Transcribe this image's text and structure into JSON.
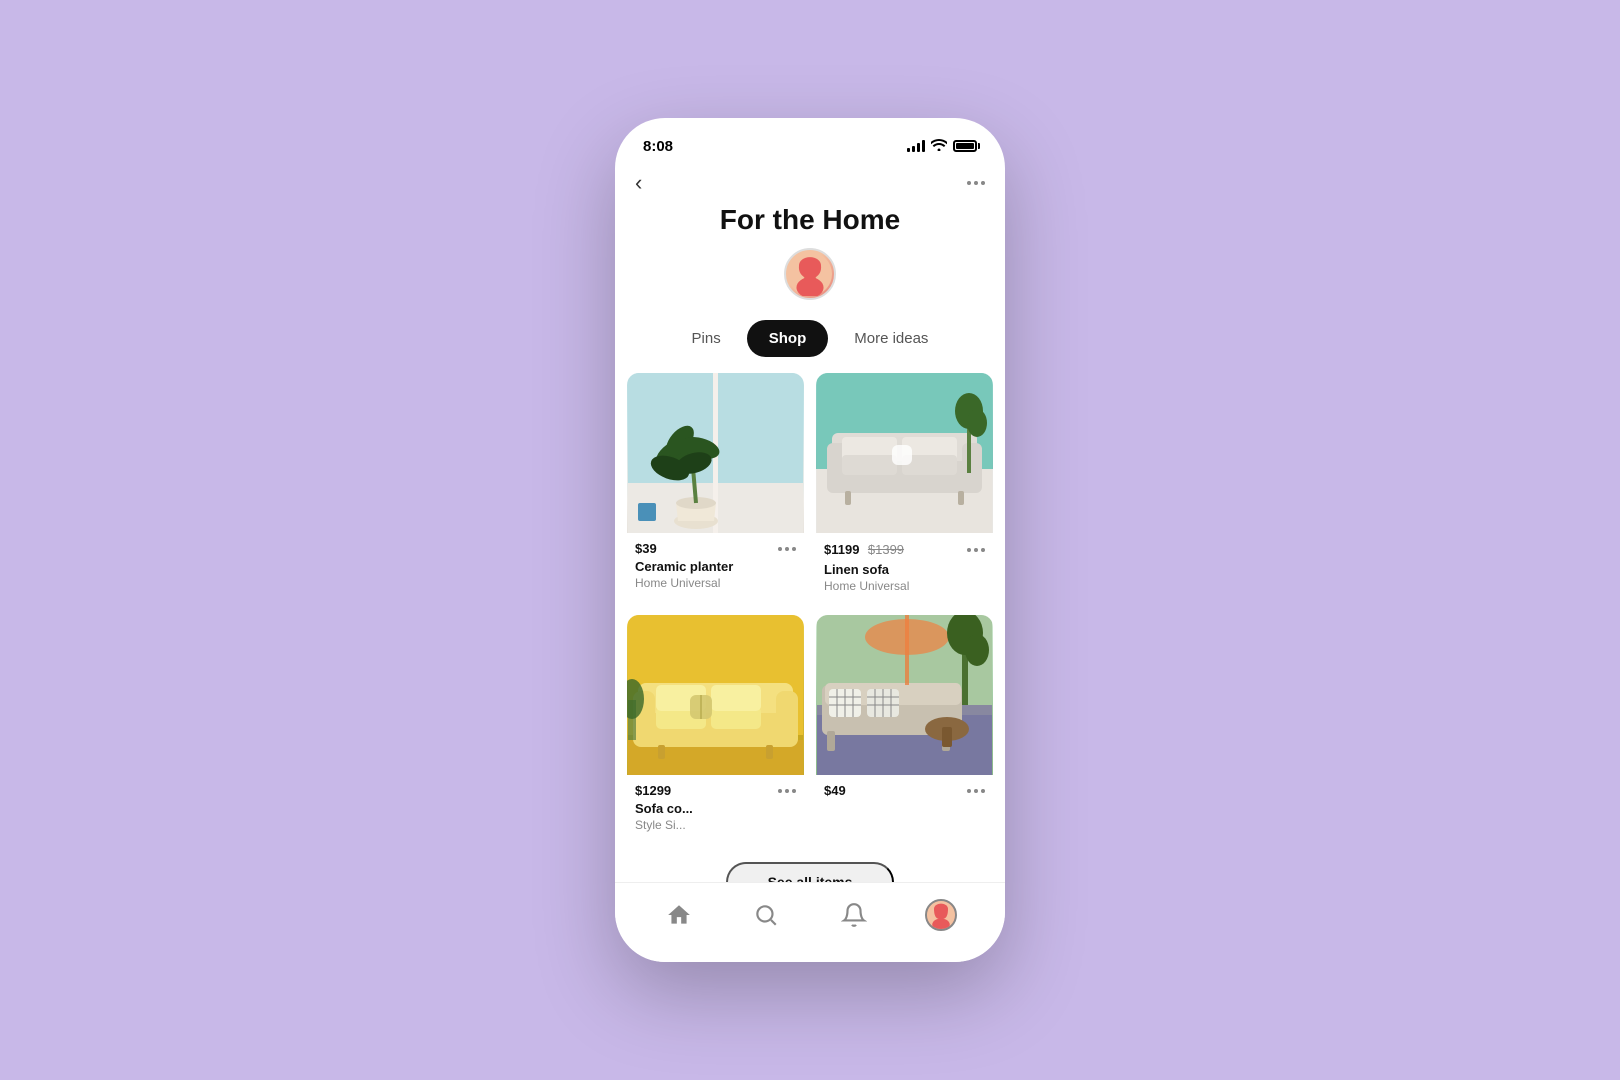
{
  "status_bar": {
    "time": "8:08"
  },
  "board": {
    "title": "For the Home",
    "back_label": "‹",
    "more_label": "•••"
  },
  "tabs": [
    {
      "id": "pins",
      "label": "Pins",
      "active": false
    },
    {
      "id": "shop",
      "label": "Shop",
      "active": true
    },
    {
      "id": "more_ideas",
      "label": "More ideas",
      "active": false
    }
  ],
  "pins": [
    {
      "id": "ceramic-planter",
      "price": "$39",
      "price_original": null,
      "name": "Ceramic planter",
      "store": "Home Universal",
      "image_type": "plant"
    },
    {
      "id": "linen-sofa",
      "price": "$1199",
      "price_original": "$1399",
      "name": "Linen sofa",
      "store": "Home Universal",
      "image_type": "sofa"
    },
    {
      "id": "sofa-couch",
      "price": "$1299",
      "price_original": null,
      "name": "Sofa co...",
      "store": "Style Si...",
      "image_type": "yellow-sofa"
    },
    {
      "id": "outdoor-set",
      "price": "$49",
      "price_original": null,
      "name": "",
      "store": "",
      "image_type": "outdoor"
    }
  ],
  "bottom_nav": {
    "home_label": "home",
    "search_label": "search",
    "bell_label": "bell",
    "profile_label": "profile"
  },
  "see_all": {
    "label": "See all items"
  }
}
